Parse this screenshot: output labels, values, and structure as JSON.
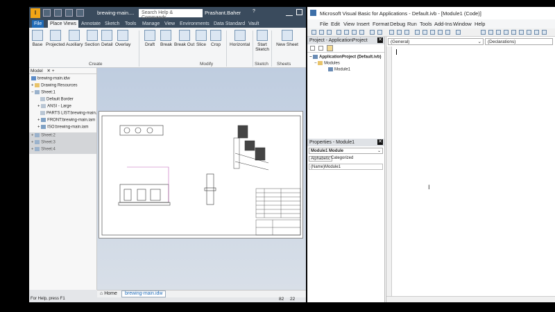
{
  "inventor": {
    "logo": "I",
    "doc_title": "brewing-main....",
    "search_placeholder": "Search Help & Commands...",
    "user": "Prashant.Baher",
    "help": "?",
    "tabs": [
      "File",
      "Place Views",
      "Annotate",
      "Sketch",
      "Tools",
      "Manage",
      "View",
      "Environments",
      "Data Standard",
      "Vault"
    ],
    "ribbon_buttons": [
      "Base",
      "Projected",
      "Auxiliary",
      "Section",
      "Detail",
      "Overlay",
      "Draft",
      "Break",
      "Break Out",
      "Slice",
      "Crop",
      "Horizontal",
      "Start Sketch",
      "New Sheet"
    ],
    "groups": [
      "Create",
      "Modify",
      "Sketch",
      "Sheets"
    ],
    "browser_tabs": [
      "Model"
    ],
    "tree": [
      {
        "label": "brewing-main.idw",
        "icon": "drawing-icon"
      },
      {
        "label": "Drawing Resources",
        "icon": "folder-icon"
      },
      {
        "label": "Sheet:1",
        "icon": "sheet-icon"
      },
      {
        "label": "Default Border",
        "icon": "border-icon"
      },
      {
        "label": "ANSI - Large",
        "icon": "titleblock-icon"
      },
      {
        "label": "PARTS LIST:brewing-main.i",
        "icon": "partslist-icon"
      },
      {
        "label": "FRONT:brewing-main.iam",
        "icon": "view-icon"
      },
      {
        "label": "ISO:brewing-main.iam",
        "icon": "view-icon"
      },
      {
        "label": "Sheet:2",
        "icon": "sheet-icon"
      },
      {
        "label": "Sheet:3",
        "icon": "sheet-icon"
      },
      {
        "label": "Sheet:4",
        "icon": "sheet-icon"
      }
    ],
    "doc_tabs": [
      "Home",
      "brewing-main.idw"
    ],
    "status_text": "For Help, press F1",
    "status_num1": "82",
    "status_num2": "22"
  },
  "vba": {
    "title": "Microsoft Visual Basic for Applications - Default.ivb - [Module1 (Code)]",
    "menu": [
      "File",
      "Edit",
      "View",
      "Insert",
      "Format",
      "Debug",
      "Run",
      "Tools",
      "Add-Ins",
      "Window",
      "Help"
    ],
    "project_title": "Project - ApplicationProject",
    "project_root": "ApplicationProject (Default.ivb)",
    "modules_folder": "Modules",
    "module1": "Module1",
    "properties_title": "Properties - Module1",
    "object_combo": "Module1 Module",
    "prop_tabs": [
      "Alphabetic",
      "Categorized"
    ],
    "prop_name_key": "(Name)",
    "prop_name_val": "Module1",
    "general_combo": "(General)",
    "declarations_combo": "(Declarations)"
  }
}
